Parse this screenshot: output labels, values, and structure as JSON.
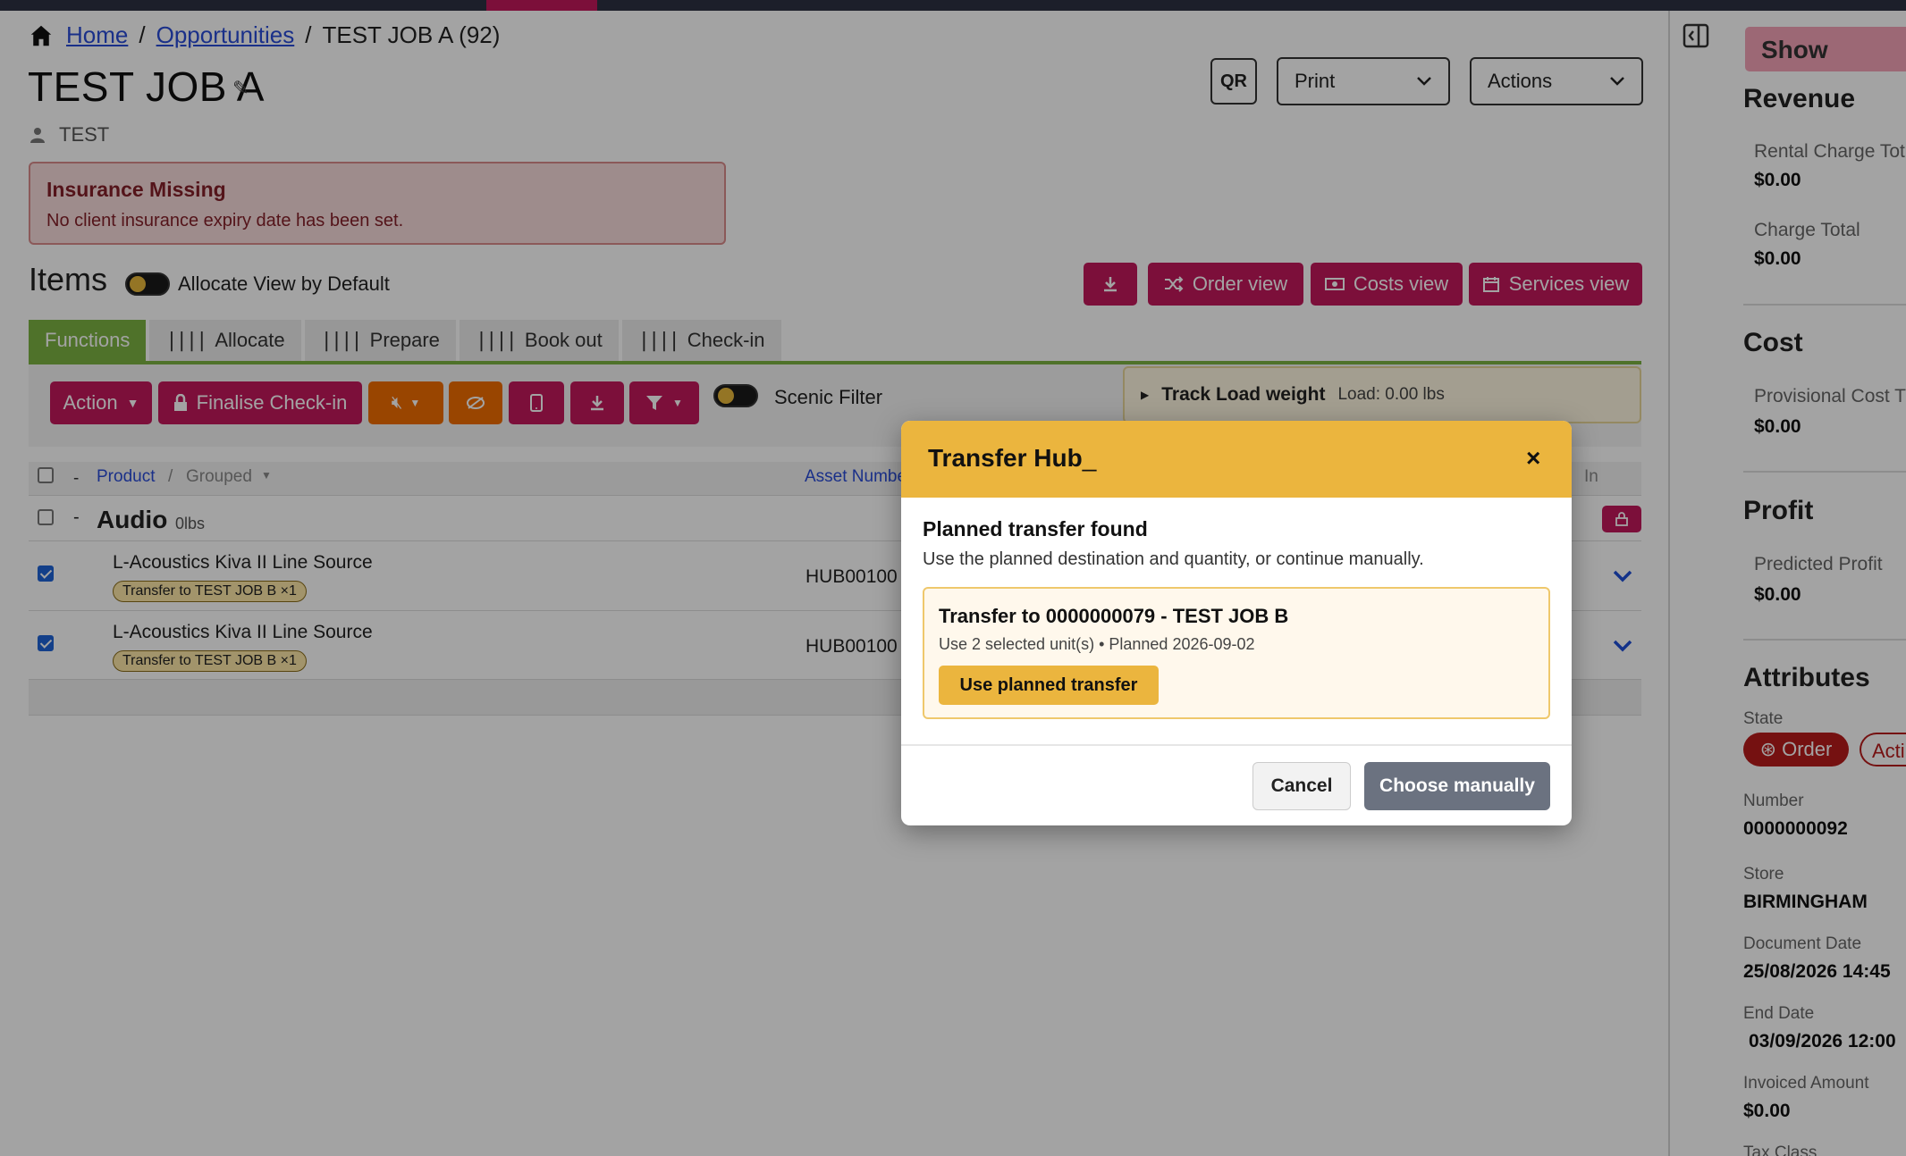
{
  "breadcrumb": {
    "home": "Home",
    "opportunities": "Opportunities",
    "current": "TEST JOB A (92)"
  },
  "page": {
    "title": "TEST JOB A",
    "subtitle": "TEST"
  },
  "header_buttons": {
    "qr": "QR",
    "print": "Print",
    "actions": "Actions"
  },
  "alert": {
    "title": "Insurance Missing",
    "message": "No client insurance expiry date has been set."
  },
  "items": {
    "heading": "Items",
    "allocate_toggle_label": "Allocate View by Default",
    "view_buttons": {
      "order": "Order view",
      "costs": "Costs view",
      "services": "Services view"
    }
  },
  "tabs": [
    "Functions",
    "Allocate",
    "Prepare",
    "Book out",
    "Check-in"
  ],
  "toolbar": {
    "action": "Action",
    "finalise": "Finalise Check-in",
    "scenic_filter": "Scenic Filter",
    "track_load": "Track Load weight",
    "load_value": "Load: 0.00 lbs"
  },
  "table": {
    "headers": {
      "dash": "-",
      "product": "Product",
      "slash": "/",
      "grouped": "Grouped",
      "asset": "Asset Number",
      "in": "In"
    },
    "group": {
      "name": "Audio",
      "weight": "0lbs",
      "dash": "-"
    },
    "rows": [
      {
        "product": "L-Acoustics Kiva II Line Source",
        "badge": "Transfer to TEST JOB B ×1",
        "asset": "HUB00100",
        "checked": true
      },
      {
        "product": "L-Acoustics Kiva II Line Source",
        "badge": "Transfer to TEST JOB B ×1",
        "asset": "HUB00100",
        "checked": true
      }
    ]
  },
  "sidebar": {
    "show": "Show",
    "revenue": {
      "title": "Revenue",
      "rental_label": "Rental Charge Tot",
      "rental_value": "$0.00",
      "charge_label": "Charge Total",
      "charge_value": "$0.00"
    },
    "cost": {
      "title": "Cost",
      "prov_label": "Provisional Cost T",
      "prov_value": "$0.00"
    },
    "profit": {
      "title": "Profit",
      "pred_label": "Predicted Profit",
      "pred_value": "$0.00"
    },
    "attributes": {
      "title": "Attributes",
      "state_label": "State",
      "state_order": "Order",
      "state_active": "Acti",
      "number_label": "Number",
      "number_value": "0000000092",
      "store_label": "Store",
      "store_value": "BIRMINGHAM",
      "docdate_label": "Document Date",
      "docdate_value": "25/08/2026 14:45",
      "enddate_label": "End Date",
      "enddate_value": "03/09/2026 12:00",
      "invoiced_label": "Invoiced Amount",
      "invoiced_value": "$0.00",
      "tax_label": "Tax Class"
    }
  },
  "modal": {
    "title": "Transfer Hub",
    "close": "×",
    "heading": "Planned transfer found",
    "description": "Use the planned destination and quantity, or continue manually.",
    "plan_title": "Transfer to 0000000079 - TEST JOB B",
    "plan_subtitle": "Use 2 selected unit(s) • Planned 2026-09-02",
    "use_planned": "Use planned transfer",
    "cancel": "Cancel",
    "choose_manually": "Choose manually"
  },
  "colors": {
    "brand": "#c2185b",
    "functions_tab": "#7cb342",
    "modal_header": "#ebb53e",
    "order_state": "#b71c1c"
  }
}
